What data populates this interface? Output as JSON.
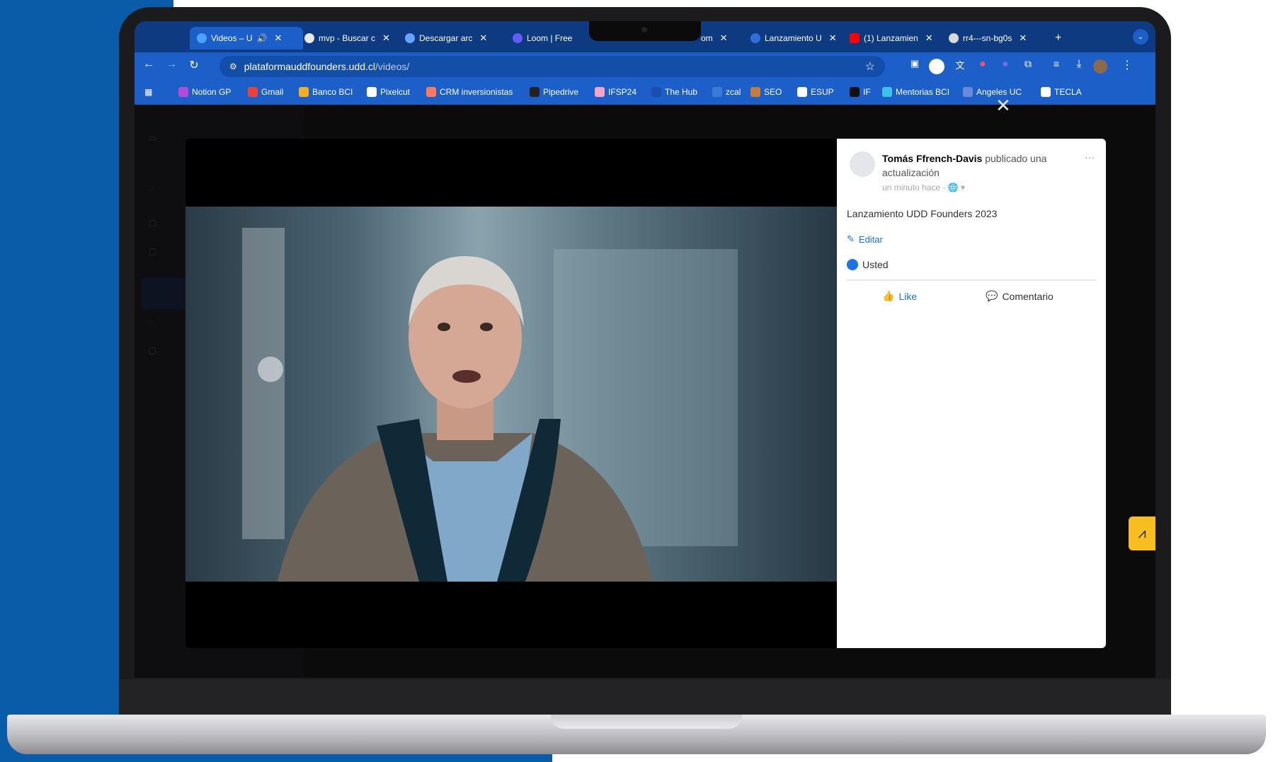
{
  "browser": {
    "tabs": [
      {
        "label": "Videos – U",
        "sound": "🔊"
      },
      {
        "label": "mvp - Buscar c"
      },
      {
        "label": "Descargar arc"
      },
      {
        "label": "Loom | Free"
      },
      {
        "label": "om"
      },
      {
        "label": "Lanzamiento U"
      },
      {
        "label": "(1) Lanzamien"
      },
      {
        "label": "rr4---sn-bg0s"
      }
    ],
    "new_tab": "+",
    "url_host": "plataformauddfounders.udd.cl",
    "url_path": "/videos/",
    "bookmarks": [
      "Notion GP",
      "Gmail",
      "Banco BCI",
      "Pixelcut",
      "CRM inversionistas",
      "Pipedrive",
      "IFSP24",
      "The Hub",
      "zcal",
      "SEO",
      "ESUP",
      "IF",
      "Mentorias BCI",
      "Angeles UC",
      "TECLA"
    ]
  },
  "post": {
    "author": "Tomás Ffrench-Davis",
    "action": " publicado una actualización",
    "time": "un minuto hace ·",
    "text": "Lanzamiento UDD Founders 2023",
    "edit_label": "Editar",
    "reaction_user": "Usted",
    "like_label": "Like",
    "comment_label": "Comentario"
  },
  "colors": {
    "brand_blue": "#0b5ca8",
    "like_blue": "#1b74e4",
    "widget_yellow": "#f6be1e"
  }
}
